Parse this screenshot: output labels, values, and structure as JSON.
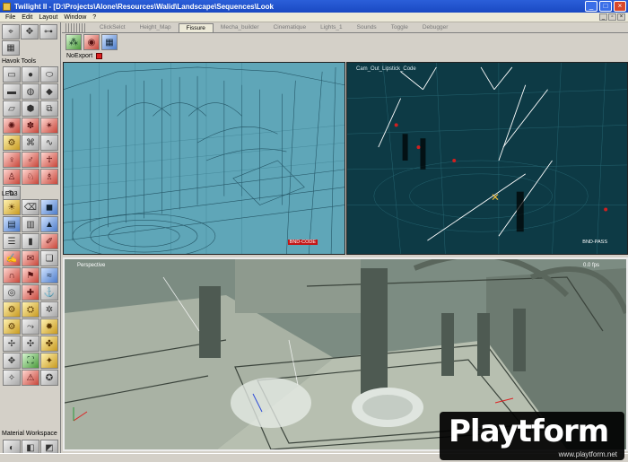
{
  "window": {
    "title": "Twilight II - [D:\\Projects\\Alone\\Resources\\Walid\\Landscape\\Sequences\\Look",
    "buttons": [
      "_",
      "□",
      "×"
    ]
  },
  "menu": [
    "File",
    "Edit",
    "Layout",
    "Window",
    "?"
  ],
  "tabs": [
    {
      "label": "ClickSelct",
      "active": false
    },
    {
      "label": "Height_Map",
      "active": false
    },
    {
      "label": "Fissure",
      "active": true
    },
    {
      "label": "Mecha_builder",
      "active": false
    },
    {
      "label": "Cinematique",
      "active": false
    },
    {
      "label": "Lights_1",
      "active": false
    },
    {
      "label": "Sounds",
      "active": false
    },
    {
      "label": "Toggle",
      "active": false
    },
    {
      "label": "Debugger",
      "active": false
    }
  ],
  "left_panel": {
    "sections": [
      "Havok Tools",
      "LED3",
      "Material Workspace"
    ]
  },
  "noexport_label": "NoExport",
  "viewports": {
    "top_right_label": "Cam_Out_Lipstick_Code",
    "bottom_label": "Perspective",
    "top_left_tag": "BND-CODE",
    "top_right_tag": "BND-PASS",
    "bottom_readout": "0.0 fps"
  },
  "watermark": {
    "logo": "Playtform",
    "url": "www.playtform.net"
  },
  "colors": {
    "titlebar": "#2458d4",
    "wireframe_bg": "#5fa6b8",
    "dark_vp_bg": "#0d3a45",
    "accent_red": "#c41616"
  }
}
